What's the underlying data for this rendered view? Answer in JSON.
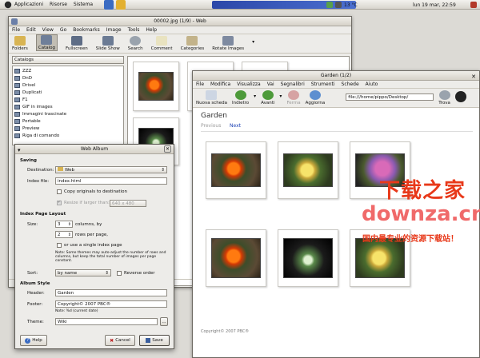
{
  "top_panel": {
    "menus": [
      "Applicazioni",
      "Risorse",
      "Sistema"
    ],
    "temperature": "13 °C",
    "clock": "lun 19 mar, 22:59"
  },
  "gthumb": {
    "title": "00002.jpg (1/9) - Web",
    "menu": [
      "File",
      "Edit",
      "View",
      "Go",
      "Bookmarks",
      "Image",
      "Tools",
      "Help"
    ],
    "toolbar": [
      "Folders",
      "Catalog",
      "Fullscreen",
      "Slide Show",
      "Search",
      "Comment",
      "Categories",
      "Rotate Images"
    ],
    "catalog_combo": "Catalogs",
    "tree": [
      "ZZZ",
      "DnD",
      "Drivel",
      "Duplicati",
      "F1",
      "GIF in images",
      "Immagini trascinate",
      "Portable",
      "Preview",
      "Riga di comando"
    ]
  },
  "dialog": {
    "title": "Web Album",
    "saving_label": "Saving",
    "destination_label": "Destination:",
    "destination_value": "Web",
    "index_file_label": "Index file:",
    "index_file_value": "index.html",
    "copy_originals": "Copy originals to destination",
    "resize_if_larger": "Resize if larger than:",
    "resize_value": "640 x 480",
    "index_layout_label": "Index Page Layout",
    "size_label": "Size:",
    "columns_value": "3",
    "columns_suffix": "columns, by",
    "rows_value": "2",
    "rows_suffix": "rows per page,",
    "single_page": "or use a single index page",
    "note1": "Note: Some themes may auto-adjust the number of rows and columns, but keep the total number of images per page constant.",
    "sort_label": "Sort:",
    "sort_value": "by name",
    "reverse_order": "Reverse order",
    "album_style_label": "Album Style",
    "header_label": "Header:",
    "header_value": "Garden",
    "footer_label": "Footer:",
    "footer_value": "Copyright© 2007 PBC®",
    "note2": "Note: %d (current date)",
    "theme_label": "Theme:",
    "theme_value": "Wiki",
    "theme_btn": "...",
    "help_btn": "Help",
    "cancel_btn": "Cancel",
    "save_btn": "Save"
  },
  "browser": {
    "title": "Garden (1/2)",
    "menu": [
      "File",
      "Modifica",
      "Visualizza",
      "Vai",
      "Segnalibri",
      "Strumenti",
      "Schede",
      "Aiuto"
    ],
    "toolbar": [
      "Nuova scheda",
      "Indietro",
      "Avanti",
      "Ferma",
      "Aggiorna",
      "Trova"
    ],
    "url": "file:///home/pippo/Desktop/",
    "page_title": "Garden",
    "prev": "Previous",
    "next": "Next",
    "footer": "Copyright© 2007 PBC®"
  },
  "watermark": {
    "line1": "下载之家",
    "line2": "downza.cn",
    "line3": "国内最专业的资源下载站！"
  },
  "colors": {
    "watermark_red": "#e8391a",
    "watermark_pink": "#f06a6a",
    "link_blue": "#1a3fb3"
  }
}
